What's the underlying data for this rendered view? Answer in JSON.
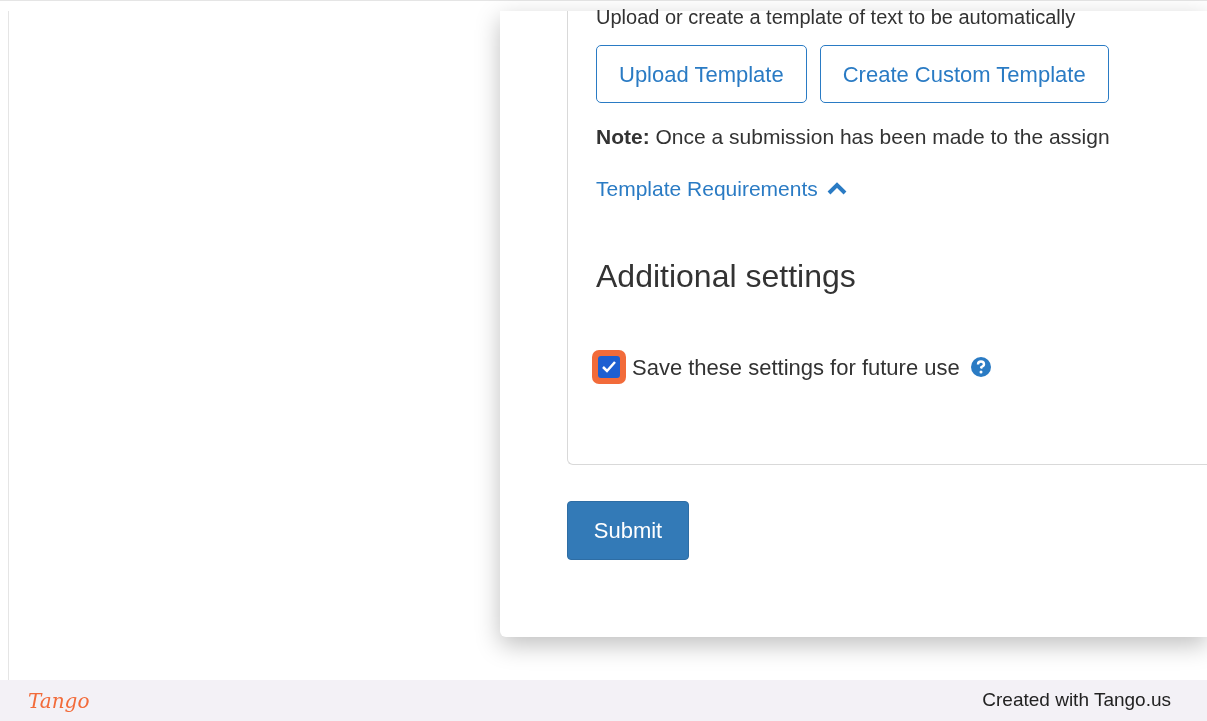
{
  "intro": "Upload or create a template of text to be automatically",
  "template_buttons": [
    "Upload Template",
    "Create Custom Template"
  ],
  "note": "**Note:** Once a submission has been made to the assign",
  "requirements_link": {
    "label": "Template Requirements",
    "expanded": true
  },
  "additional_settings": {
    "heading": "Additional settings",
    "checkbox": {
      "label": "Save these settings for future use",
      "checked": true,
      "highlighted": true
    }
  },
  "submit": "Submit",
  "footer": {
    "logo": "Tango",
    "credit": "Created with Tango.us"
  }
}
